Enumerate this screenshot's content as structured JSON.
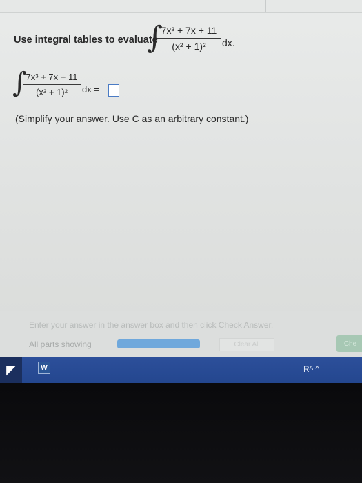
{
  "question": {
    "prompt": "Use integral tables to evaluate",
    "numerator": "7x³ + 7x + 11",
    "denominator": "(x² + 1)²",
    "integral_sign": "∫",
    "differential": "dx.",
    "answer_differential": "dx =",
    "instruction": "(Simplify your answer. Use C as an arbitrary constant.)"
  },
  "footer": {
    "hint": "Enter your answer in the answer box and then click Check Answer.",
    "parts_label": "All parts showing",
    "progress_fraction": 1.0,
    "clear_all_label": "Clear All",
    "check_answer_label": "Che"
  },
  "taskbar": {
    "start_glyph": "◤",
    "app_label": "W",
    "tray_text": "Rᴬ  ^"
  },
  "colors": {
    "accent_blue": "#6fa8dc",
    "taskbar_blue": "#2c4f9a",
    "check_green": "#a7c8b4"
  }
}
